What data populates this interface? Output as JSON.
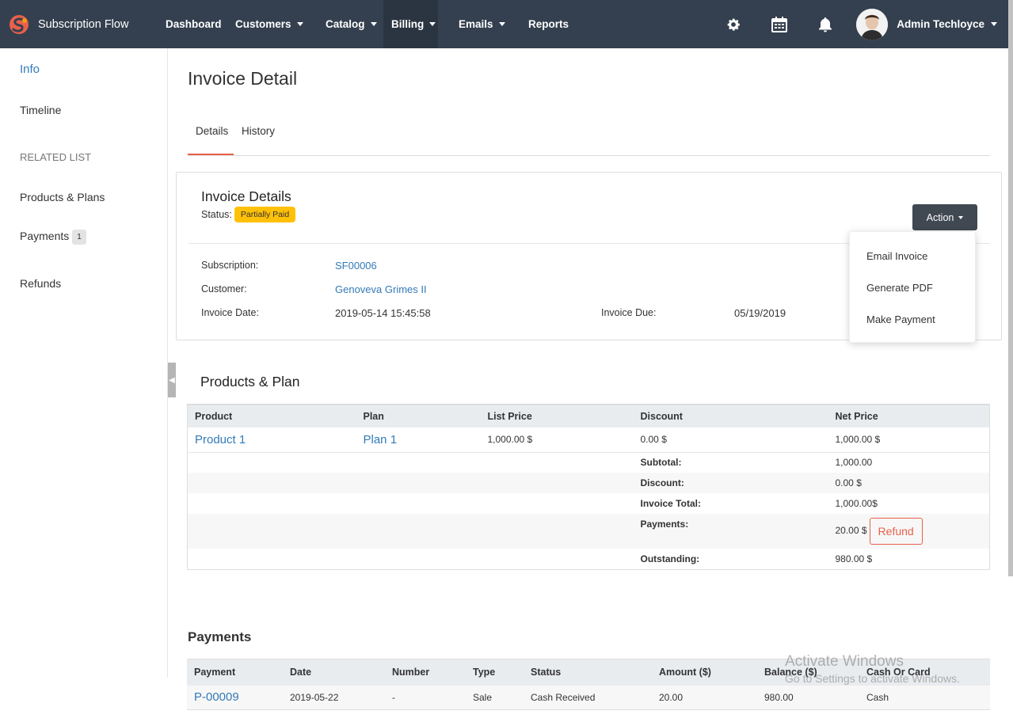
{
  "brand": {
    "name": "Subscription Flow"
  },
  "nav": {
    "items": [
      {
        "label": "Dashboard",
        "caret": false
      },
      {
        "label": "Customers",
        "caret": true
      },
      {
        "label": "Catalog",
        "caret": true
      },
      {
        "label": "Billing",
        "caret": true,
        "active": true
      },
      {
        "label": "Emails",
        "caret": true
      },
      {
        "label": "Reports",
        "caret": false
      }
    ],
    "user_name": "Admin Techloyce"
  },
  "sidebar": {
    "info": "Info",
    "timeline": "Timeline",
    "related_header": "RELATED LIST",
    "products_plans": "Products & Plans",
    "payments": "Payments",
    "payments_count": "1",
    "refunds": "Refunds"
  },
  "page": {
    "title": "Invoice Detail",
    "tabs": {
      "details": "Details",
      "history": "History"
    }
  },
  "invoice": {
    "card_title": "Invoice Details",
    "status_label": "Status:",
    "status_value": "Partially Paid",
    "action_label": "Action",
    "subscription_label": "Subscription:",
    "subscription_value": "SF00006",
    "customer_label": "Customer:",
    "customer_value": "Genoveva Grimes II",
    "invoice_date_label": "Invoice Date:",
    "invoice_date_value": "2019-05-14 15:45:58",
    "invoice_due_label": "Invoice Due:",
    "invoice_due_value": "05/19/2019"
  },
  "action_menu": {
    "email_invoice": "Email Invoice",
    "generate_pdf": "Generate PDF",
    "make_payment": "Make Payment"
  },
  "products": {
    "title": "Products & Plan",
    "headers": {
      "product": "Product",
      "plan": "Plan",
      "list_price": "List Price",
      "discount": "Discount",
      "net_price": "Net Price"
    },
    "row": {
      "product": "Product 1",
      "plan": "Plan 1",
      "list_price": "1,000.00 $",
      "discount": "0.00 $",
      "net_price": "1,000.00 $"
    },
    "summary": {
      "subtotal_label": "Subtotal:",
      "subtotal_value": "1,000.00",
      "discount_label": "Discount:",
      "discount_value": "0.00 $",
      "invoice_total_label": "Invoice Total:",
      "invoice_total_value": "1,000.00$",
      "payments_label": "Payments:",
      "payments_value": "20.00 $",
      "refund_label": "Refund",
      "outstanding_label": "Outstanding:",
      "outstanding_value": "980.00 $"
    }
  },
  "payments": {
    "title": "Payments",
    "headers": {
      "payment": "Payment",
      "date": "Date",
      "number": "Number",
      "type": "Type",
      "status": "Status",
      "amount": "Amount ($)",
      "balance": "Balance ($)",
      "cash_or_card": "Cash Or Card"
    },
    "row": {
      "payment": "P-00009",
      "date": "2019-05-22",
      "number": "-",
      "type": "Sale",
      "status": "Cash Received",
      "amount": "20.00",
      "balance": "980.00",
      "cash_or_card": "Cash"
    }
  },
  "watermark": {
    "line1": "Activate Windows",
    "line2": "Go to Settings to activate Windows."
  },
  "colors": {
    "navbar": "#34404f",
    "accent": "#e8604c",
    "link": "#337ab7",
    "status_badge": "#ffc107",
    "action_button": "#404852"
  }
}
